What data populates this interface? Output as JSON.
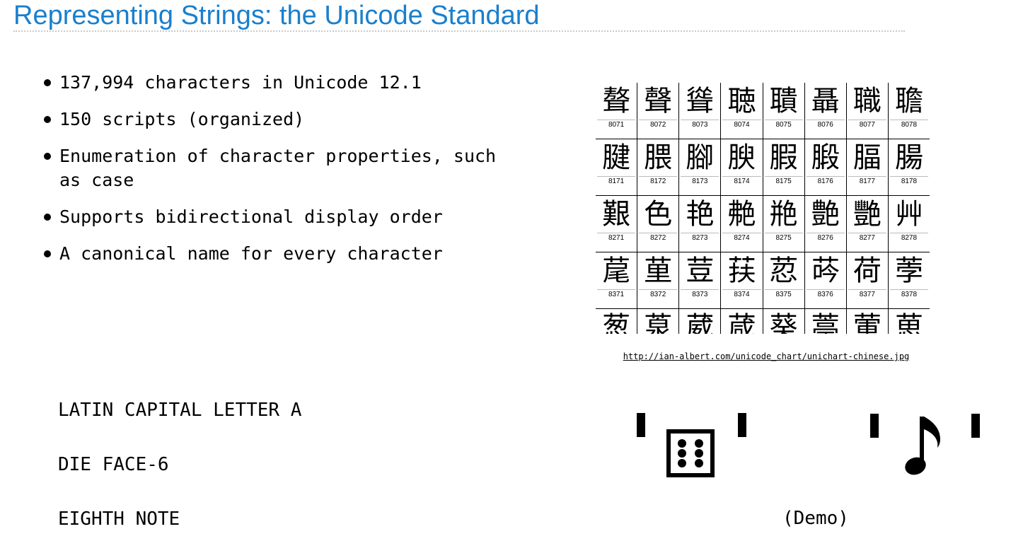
{
  "slide": {
    "title": "Representing Strings: the Unicode Standard",
    "bullets": [
      "137,994 characters in Unicode 12.1",
      "150 scripts (organized)",
      "Enumeration of character properties, such as case",
      "Supports bidirectional display order",
      "A canonical name for every character"
    ],
    "chart_caption": "http://ian-albert.com/unicode_chart/unichart-chinese.jpg",
    "names": [
      "LATIN CAPITAL LETTER A",
      "DIE FACE-6",
      "EIGHTH NOTE"
    ],
    "demo_label": "(Demo)",
    "chart_rows": [
      {
        "glyphs": [
          "聱",
          "聲",
          "聳",
          "聴",
          "聵",
          "聶",
          "職",
          "聸"
        ],
        "codes": [
          "8071",
          "8072",
          "8073",
          "8074",
          "8075",
          "8076",
          "8077",
          "8078"
        ]
      },
      {
        "glyphs": [
          "腱",
          "腲",
          "腳",
          "腴",
          "腵",
          "腶",
          "腷",
          "腸"
        ],
        "codes": [
          "8171",
          "8172",
          "8173",
          "8174",
          "8175",
          "8176",
          "8177",
          "8178"
        ]
      },
      {
        "glyphs": [
          "艱",
          "色",
          "艳",
          "艴",
          "艵",
          "艶",
          "艷",
          "艸"
        ],
        "codes": [
          "8271",
          "8272",
          "8273",
          "8274",
          "8275",
          "8276",
          "8277",
          "8278"
        ]
      },
      {
        "glyphs": [
          "荱",
          "荲",
          "荳",
          "荴",
          "荵",
          "荶",
          "荷",
          "荸"
        ],
        "codes": [
          "8371",
          "8372",
          "8373",
          "8374",
          "8375",
          "8376",
          "8377",
          "8378"
        ]
      },
      {
        "glyphs": [
          "葱",
          "葲",
          "葳",
          "葴",
          "葵",
          "葶",
          "葷",
          "葸"
        ],
        "codes": [
          "",
          "",
          "",
          "",
          "",
          "",
          "",
          ""
        ]
      }
    ],
    "glyph_examples": {
      "die": "die-face-6-icon",
      "note": "eighth-note-icon"
    }
  }
}
